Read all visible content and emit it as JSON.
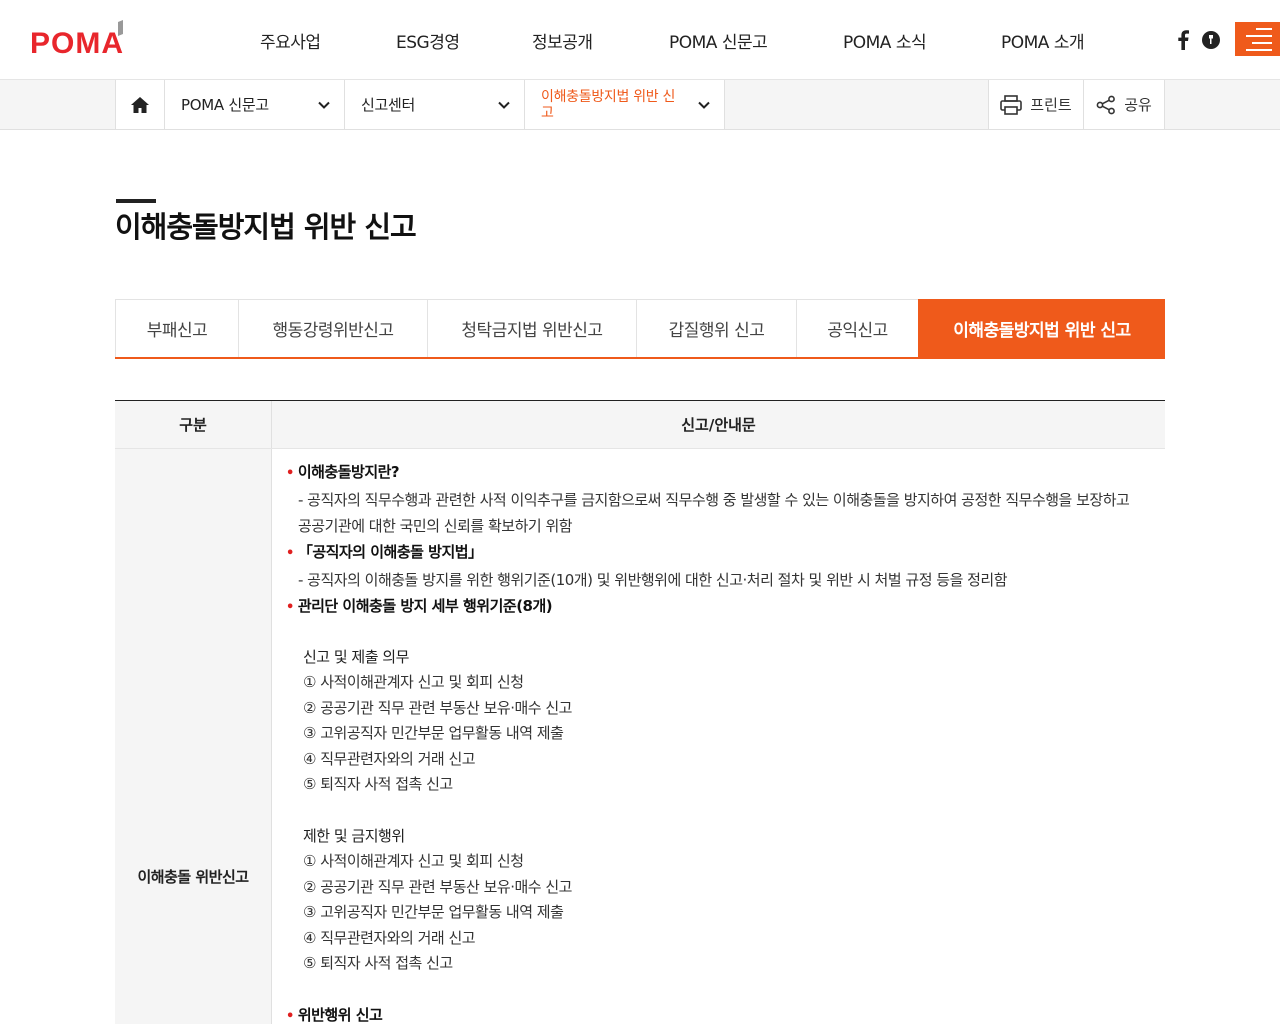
{
  "header": {
    "logo_text": "POMA",
    "nav": [
      "주요사업",
      "ESG경영",
      "정보공개",
      "POMA 신문고",
      "POMA 소식",
      "POMA 소개"
    ],
    "sns": [
      "facebook-icon",
      "blog-icon"
    ],
    "accent": "#ef5a1b"
  },
  "location": {
    "depth1": "POMA 신문고",
    "depth2": "신고센터",
    "depth3": "이해충돌방지법 위반 신고",
    "print": "프린트",
    "share": "공유"
  },
  "page": {
    "title": "이해충돌방지법 위반 신고"
  },
  "tabs": [
    {
      "label": "부패신고",
      "active": false
    },
    {
      "label": "행동강령위반신고",
      "active": false
    },
    {
      "label": "청탁금지법 위반신고",
      "active": false
    },
    {
      "label": "갑질행위 신고",
      "active": false
    },
    {
      "label": "공익신고",
      "active": false
    },
    {
      "label": "이해충돌방지법 위반 신고",
      "active": true
    }
  ],
  "table": {
    "headers": [
      "구분",
      "신고/안내문"
    ],
    "category": "이해충돌 위반신고",
    "content": {
      "b1": "이해충돌방지란?",
      "d1a": "- 공직자의 직무수행과 관련한 사적 이익추구를 금지함으로써 직무수행 중 발생할 수 있는 이해충돌을 방지하여 공정한 직무수행을 보장하고",
      "d1b": "공공기관에 대한 국민의 신뢰를 확보하기 위함",
      "b2": "「공직자의 이해충돌 방지법」",
      "d2": "- 공직자의 이해충돌 방지를 위한 행위기준(10개) 및 위반행위에 대한 신고·처리 절차 및 위반 시 처벌 규정 등을 정리함",
      "b3": "관리단 이해충돌 방지 세부 행위기준(8개)",
      "h1": "신고 및 제출 의무",
      "list1": [
        "① 사적이해관계자 신고 및 회피 신청",
        "② 공공기관 직무 관련 부동산 보유·매수 신고",
        "③ 고위공직자 민간부문 업무활동 내역 제출",
        "④ 직무관련자와의 거래 신고",
        "⑤ 퇴직자 사적 접촉 신고"
      ],
      "h2": "제한 및 금지행위",
      "list2": [
        "① 사적이해관계자 신고 및 회피 신청",
        "② 공공기관 직무 관련 부동산 보유·매수 신고",
        "③ 고위공직자 민간부문 업무활동 내역 제출",
        "④ 직무관련자와의 거래 신고",
        "⑤ 퇴직자 사적 접촉 신고"
      ],
      "b4": "위반행위 신고"
    }
  }
}
